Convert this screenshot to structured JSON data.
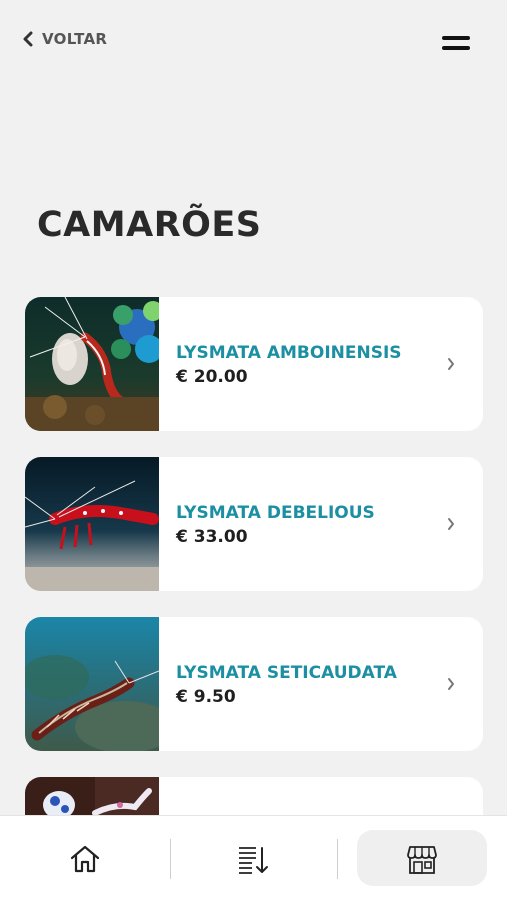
{
  "header": {
    "back_label": "VOLTAR",
    "menu_icon": "menu-icon"
  },
  "page": {
    "title": "CAMARÕES"
  },
  "products": [
    {
      "name": "LYSMATA AMBOINENSIS",
      "price": "€ 20.00",
      "image": "lysmata-amboinensis-photo"
    },
    {
      "name": "LYSMATA DEBELIOUS",
      "price": "€ 33.00",
      "image": "lysmata-debelious-photo"
    },
    {
      "name": "LYSMATA SETICAUDATA",
      "price": "€ 9.50",
      "image": "lysmata-seticaudata-photo"
    },
    {
      "name": "",
      "price": "",
      "image": "harlequin-shrimp-photo"
    }
  ],
  "bottom_nav": {
    "items": [
      {
        "icon": "home-icon",
        "active": false
      },
      {
        "icon": "sort-list-icon",
        "active": false
      },
      {
        "icon": "store-icon",
        "active": true
      }
    ]
  },
  "colors": {
    "background": "#f1f1f1",
    "card": "#ffffff",
    "accent": "#1c8fa3",
    "text": "#1f1f1f"
  }
}
